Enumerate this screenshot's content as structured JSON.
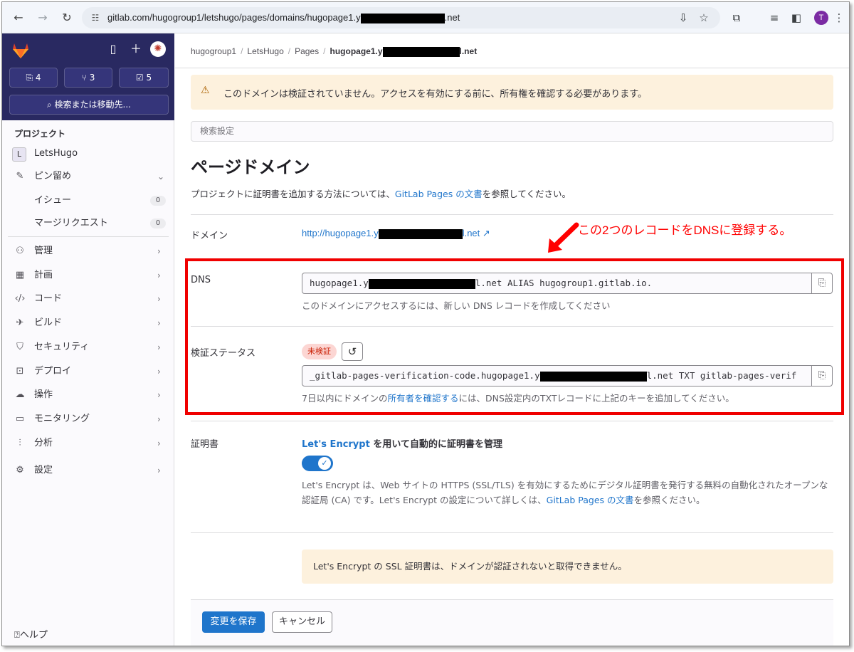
{
  "browser": {
    "url_prefix": "gitlab.com/hugogroup1/letshugo/pages/domains/hugopage1.y",
    "url_suffix": ".net",
    "avatar_initial": "T"
  },
  "sidebar": {
    "counts": {
      "issues": "4",
      "merge_requests": "3",
      "todos": "5"
    },
    "search_label": "検索または移動先...",
    "section_title": "プロジェクト",
    "project_initial": "L",
    "project_name": "LetsHugo",
    "pinned_label": "ピン留め",
    "pinned_items": [
      {
        "label": "イシュー",
        "count": "0"
      },
      {
        "label": "マージリクエスト",
        "count": "0"
      }
    ],
    "nav_items": [
      {
        "label": "管理"
      },
      {
        "label": "計画"
      },
      {
        "label": "コード"
      },
      {
        "label": "ビルド"
      },
      {
        "label": "セキュリティ"
      },
      {
        "label": "デプロイ"
      },
      {
        "label": "操作"
      },
      {
        "label": "モニタリング"
      },
      {
        "label": "分析"
      },
      {
        "label": "設定"
      }
    ],
    "help_label": "ヘルプ"
  },
  "breadcrumb": {
    "group": "hugogroup1",
    "project": "LetsHugo",
    "section": "Pages",
    "current_prefix": "hugopage1.y",
    "current_suffix": "l.net"
  },
  "warning_alert": "このドメインは検証されていません。アクセスを有効にする前に、所有権を確認する必要があります。",
  "search_settings_placeholder": "検索設定",
  "page": {
    "title": "ページドメイン",
    "desc_before": "プロジェクトに証明書を追加する方法については、",
    "desc_link": "GitLab Pages の文書",
    "desc_after": "を参照してください。"
  },
  "domain": {
    "label": "ドメイン",
    "link_prefix": "http://hugopage1.y",
    "link_suffix": "l.net"
  },
  "annotation": "この2つのレコードをDNSに登録する。",
  "dns": {
    "label": "DNS",
    "value_prefix": "hugopage1.y",
    "value_suffix": "l.net ALIAS hugogroup1.gitlab.io.",
    "help": "このドメインにアクセスするには、新しい DNS レコードを作成してください"
  },
  "verification": {
    "label": "検証ステータス",
    "badge": "未検証",
    "value_prefix": "_gitlab-pages-verification-code.hugopage1.y",
    "value_suffix": "l.net TXT gitlab-pages-verif",
    "help_before": "7日以内にドメインの",
    "help_link": "所有者を確認する",
    "help_after": "には、DNS設定内のTXTレコードに上記のキーを追加してください。"
  },
  "certificate": {
    "label": "証明書",
    "heading_link": "Let's Encrypt",
    "heading_rest": " を用いて自動的に証明書を管理",
    "toggle_on": true,
    "desc_before": "Let's Encrypt は、Web サイトの HTTPS (SSL/TLS) を有効にするためにデジタル証明書を発行する無料の自動化されたオープンな認証局 (CA) です。Let's Encrypt の設定について詳しくは、",
    "desc_link": "GitLab Pages の文書",
    "desc_after": "を参照ください。",
    "info": "Let's Encrypt の SSL 証明書は、ドメインが認証されないと取得できません。"
  },
  "buttons": {
    "save": "変更を保存",
    "cancel": "キャンセル"
  },
  "colors": {
    "accent": "#1f75cb",
    "sidebar_top": "#292961",
    "annotation_red": "#ff0000",
    "warning_bg": "#fdf1dd"
  }
}
